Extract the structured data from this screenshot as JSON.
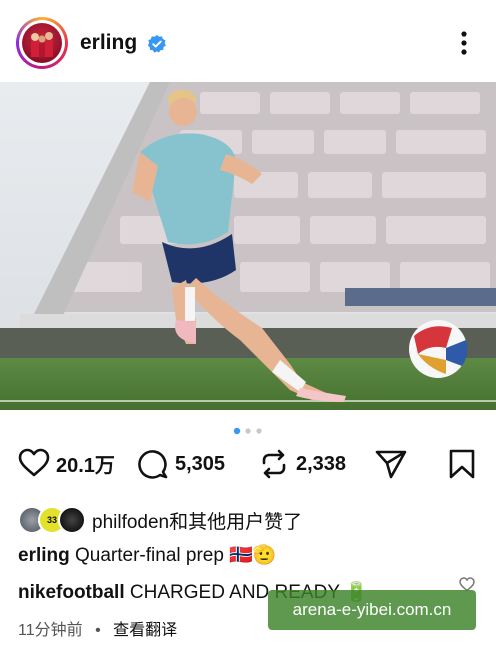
{
  "post": {
    "username": "erling",
    "verified_icon": "verified-badge-icon",
    "more_icon": "more-vertical-icon"
  },
  "actions": {
    "likes": "20.1万",
    "comments": "5,305",
    "reposts": "2,338"
  },
  "liked_by": {
    "avatar_badge": "33",
    "text": "philfoden和其他用户赞了"
  },
  "caption": {
    "username": "erling",
    "text": "Quarter-final prep 🇳🇴🫡"
  },
  "top_comment": {
    "username": "nikefootball",
    "text": "CHARGED AND READY 🔋"
  },
  "meta": {
    "time": "11分钟前",
    "separator": "•",
    "translate": "查看翻译"
  },
  "carousel": {
    "count": 3,
    "active": 0
  },
  "watermark": "arena-e-yibei.com.cn",
  "colors": {
    "accent": "#3897f0",
    "pitch": "#4f7a3a",
    "shirt": "#86c3cf"
  }
}
